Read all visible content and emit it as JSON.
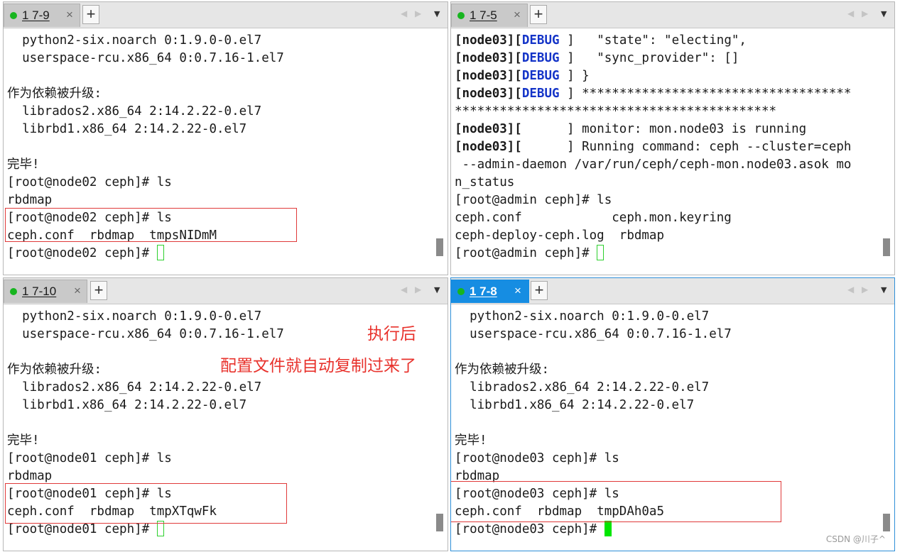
{
  "ui": {
    "close_glyph": "×",
    "add_glyph": "+",
    "prev_glyph": "◀",
    "next_glyph": "▶",
    "menu_glyph": "▼"
  },
  "colors": {
    "tab_active": "#168de2",
    "status_dot": "#17b51f",
    "debug_text": "#1434c8",
    "annotation": "#e8322c",
    "highlight_box": "#e03a3a",
    "cursor": "#00e600"
  },
  "panes": {
    "tl": {
      "tab_label": "1 7-9",
      "lines": [
        [
          {
            "t": "  python2-six.noarch 0:1.9.0-0.el7"
          }
        ],
        [
          {
            "t": "  userspace-rcu.x86_64 0:0.7.16-1.el7"
          }
        ],
        [
          {
            "t": ""
          }
        ],
        [
          {
            "t": "作为依赖被升级:"
          }
        ],
        [
          {
            "t": "  librados2.x86_64 2:14.2.22-0.el7"
          }
        ],
        [
          {
            "t": "  librbd1.x86_64 2:14.2.22-0.el7"
          }
        ],
        [
          {
            "t": ""
          }
        ],
        [
          {
            "t": "完毕!"
          }
        ],
        [
          {
            "t": "[root@node02 ceph]# ls"
          }
        ],
        [
          {
            "t": "rbdmap"
          }
        ],
        [
          {
            "t": "[root@node02 ceph]# ls"
          }
        ],
        [
          {
            "t": "ceph.conf  rbdmap  tmpsNIDmM"
          }
        ],
        [
          {
            "t": "[root@node02 ceph]# "
          },
          {
            "cursor": "hollow"
          }
        ]
      ]
    },
    "tr": {
      "tab_label": "1 7-5",
      "lines": [
        [
          {
            "t": "[",
            "c": "b"
          },
          {
            "t": "node03",
            "c": "b"
          },
          {
            "t": "][",
            "c": "b"
          },
          {
            "t": "DEBUG",
            "c": "dbg"
          },
          {
            "t": " ]   \"state\": \"electing\","
          }
        ],
        [
          {
            "t": "[",
            "c": "b"
          },
          {
            "t": "node03",
            "c": "b"
          },
          {
            "t": "][",
            "c": "b"
          },
          {
            "t": "DEBUG",
            "c": "dbg"
          },
          {
            "t": " ]   \"sync_provider\": []"
          }
        ],
        [
          {
            "t": "[",
            "c": "b"
          },
          {
            "t": "node03",
            "c": "b"
          },
          {
            "t": "][",
            "c": "b"
          },
          {
            "t": "DEBUG",
            "c": "dbg"
          },
          {
            "t": " ] }"
          }
        ],
        [
          {
            "t": "[",
            "c": "b"
          },
          {
            "t": "node03",
            "c": "b"
          },
          {
            "t": "][",
            "c": "b"
          },
          {
            "t": "DEBUG",
            "c": "dbg"
          },
          {
            "t": " ] ************************************"
          }
        ],
        [
          {
            "t": "*******************************************"
          }
        ],
        [
          {
            "t": "[",
            "c": "b"
          },
          {
            "t": "node03",
            "c": "b"
          },
          {
            "t": "][",
            "c": "b"
          },
          {
            "t": "      ] monitor: mon.node03 is running"
          }
        ],
        [
          {
            "t": "[",
            "c": "b"
          },
          {
            "t": "node03",
            "c": "b"
          },
          {
            "t": "][",
            "c": "b"
          },
          {
            "t": "      ] Running command: ceph --cluster=ceph"
          }
        ],
        [
          {
            "t": " --admin-daemon /var/run/ceph/ceph-mon.node03.asok mo"
          }
        ],
        [
          {
            "t": "n_status"
          }
        ],
        [
          {
            "t": "[root@admin ceph]# ls"
          }
        ],
        [
          {
            "t": "ceph.conf            ceph.mon.keyring"
          }
        ],
        [
          {
            "t": "ceph-deploy-ceph.log  rbdmap"
          }
        ],
        [
          {
            "t": "[root@admin ceph]# "
          },
          {
            "cursor": "hollow"
          }
        ]
      ]
    },
    "bl": {
      "tab_label": "1 7-10",
      "lines": [
        [
          {
            "t": "  python2-six.noarch 0:1.9.0-0.el7"
          }
        ],
        [
          {
            "t": "  userspace-rcu.x86_64 0:0.7.16-1.el7"
          }
        ],
        [
          {
            "t": ""
          }
        ],
        [
          {
            "t": "作为依赖被升级:"
          }
        ],
        [
          {
            "t": "  librados2.x86_64 2:14.2.22-0.el7"
          }
        ],
        [
          {
            "t": "  librbd1.x86_64 2:14.2.22-0.el7"
          }
        ],
        [
          {
            "t": ""
          }
        ],
        [
          {
            "t": "完毕!"
          }
        ],
        [
          {
            "t": "[root@node01 ceph]# ls"
          }
        ],
        [
          {
            "t": "rbdmap"
          }
        ],
        [
          {
            "t": "[root@node01 ceph]# ls"
          }
        ],
        [
          {
            "t": "ceph.conf  rbdmap  tmpXTqwFk"
          }
        ],
        [
          {
            "t": "[root@node01 ceph]# "
          },
          {
            "cursor": "hollow"
          }
        ]
      ],
      "annotation_1": "执行后",
      "annotation_2": "配置文件就自动复制过来了"
    },
    "br": {
      "tab_label": "1 7-8",
      "lines": [
        [
          {
            "t": "  python2-six.noarch 0:1.9.0-0.el7"
          }
        ],
        [
          {
            "t": "  userspace-rcu.x86_64 0:0.7.16-1.el7"
          }
        ],
        [
          {
            "t": ""
          }
        ],
        [
          {
            "t": "作为依赖被升级:"
          }
        ],
        [
          {
            "t": "  librados2.x86_64 2:14.2.22-0.el7"
          }
        ],
        [
          {
            "t": "  librbd1.x86_64 2:14.2.22-0.el7"
          }
        ],
        [
          {
            "t": ""
          }
        ],
        [
          {
            "t": "完毕!"
          }
        ],
        [
          {
            "t": "[root@node03 ceph]# ls"
          }
        ],
        [
          {
            "t": "rbdmap"
          }
        ],
        [
          {
            "t": "[root@node03 ceph]# ls"
          }
        ],
        [
          {
            "t": "ceph.conf  rbdmap  tmpDAh0a5"
          }
        ],
        [
          {
            "t": "[root@node03 ceph]# "
          },
          {
            "cursor": "solid"
          }
        ]
      ]
    }
  },
  "watermark": "CSDN @川子^"
}
